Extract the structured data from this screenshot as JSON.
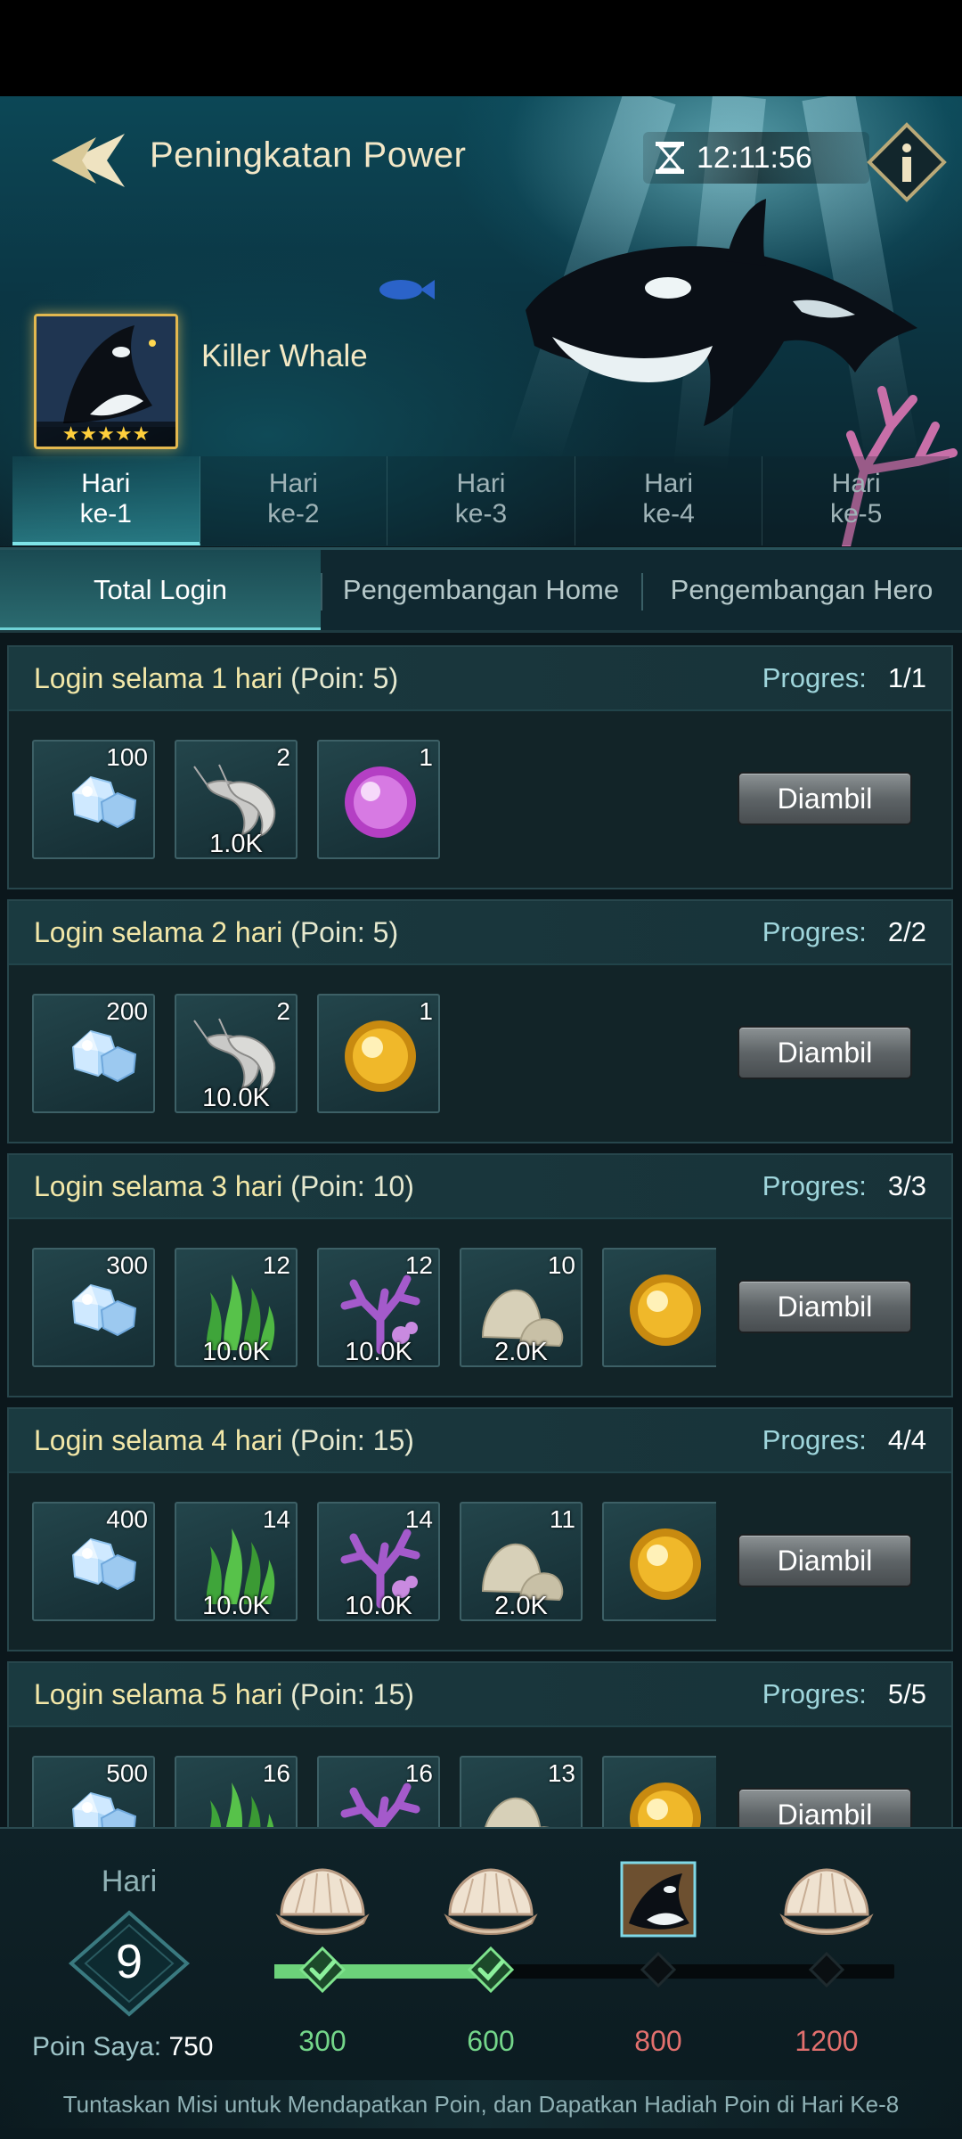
{
  "header": {
    "title": "Peningkatan Power",
    "timer": "12:11:56"
  },
  "hero": {
    "name": "Killer Whale",
    "stars": "★★★★★"
  },
  "day_tabs": [
    {
      "line1": "Hari",
      "line2": "ke-1"
    },
    {
      "line1": "Hari",
      "line2": "ke-2"
    },
    {
      "line1": "Hari",
      "line2": "ke-3"
    },
    {
      "line1": "Hari",
      "line2": "ke-4"
    },
    {
      "line1": "Hari",
      "line2": "ke-5"
    }
  ],
  "tabs": [
    "Total Login",
    "Pengembangan Home",
    "Pengembangan Hero"
  ],
  "progress_label": "Progres:",
  "claim_label": "Diambil",
  "missions": [
    {
      "title": "Login selama 1 hari",
      "points": "(Poin: 5)",
      "progress": "1/1",
      "rewards": [
        {
          "icon": "diamond-icon",
          "qty": "100",
          "amt": ""
        },
        {
          "icon": "shrimp-icon",
          "qty": "2",
          "amt": "1.0K"
        },
        {
          "icon": "purple-orb-icon",
          "qty": "1",
          "amt": ""
        }
      ]
    },
    {
      "title": "Login selama 2 hari",
      "points": "(Poin: 5)",
      "progress": "2/2",
      "rewards": [
        {
          "icon": "diamond-icon",
          "qty": "200",
          "amt": ""
        },
        {
          "icon": "shrimp-icon",
          "qty": "2",
          "amt": "10.0K"
        },
        {
          "icon": "gold-orb-icon",
          "qty": "1",
          "amt": ""
        }
      ]
    },
    {
      "title": "Login selama 3 hari",
      "points": "(Poin: 10)",
      "progress": "3/3",
      "rewards": [
        {
          "icon": "diamond-icon",
          "qty": "300",
          "amt": ""
        },
        {
          "icon": "seaweed-icon",
          "qty": "12",
          "amt": "10.0K"
        },
        {
          "icon": "coral-icon",
          "qty": "12",
          "amt": "10.0K"
        },
        {
          "icon": "stone-icon",
          "qty": "10",
          "amt": "2.0K"
        },
        {
          "icon": "gold-orb-icon",
          "qty": "",
          "amt": ""
        }
      ]
    },
    {
      "title": "Login selama 4 hari",
      "points": "(Poin: 15)",
      "progress": "4/4",
      "rewards": [
        {
          "icon": "diamond-icon",
          "qty": "400",
          "amt": ""
        },
        {
          "icon": "seaweed-icon",
          "qty": "14",
          "amt": "10.0K"
        },
        {
          "icon": "coral-icon",
          "qty": "14",
          "amt": "10.0K"
        },
        {
          "icon": "stone-icon",
          "qty": "11",
          "amt": "2.0K"
        },
        {
          "icon": "gold-orb-icon",
          "qty": "",
          "amt": ""
        }
      ]
    },
    {
      "title": "Login selama 5 hari",
      "points": "(Poin: 15)",
      "progress": "5/5",
      "rewards": [
        {
          "icon": "diamond-icon",
          "qty": "500",
          "amt": ""
        },
        {
          "icon": "seaweed-icon",
          "qty": "16",
          "amt": ""
        },
        {
          "icon": "coral-icon",
          "qty": "16",
          "amt": ""
        },
        {
          "icon": "stone-icon",
          "qty": "13",
          "amt": ""
        },
        {
          "icon": "gold-orb-icon",
          "qty": "",
          "amt": ""
        }
      ]
    }
  ],
  "footer": {
    "day_label": "Hari",
    "day_number": "9",
    "my_points_label": "Poin Saya:",
    "my_points_value": "750",
    "points_progress_fraction": 0.37,
    "milestones": [
      {
        "points": "300",
        "reached": true,
        "reward_icon": "shell-chest-icon",
        "color": "#74d68a"
      },
      {
        "points": "600",
        "reached": true,
        "reward_icon": "shell-chest-icon",
        "color": "#74d68a"
      },
      {
        "points": "800",
        "reached": false,
        "reward_icon": "orca-hero-icon",
        "color": "#e2706e"
      },
      {
        "points": "1200",
        "reached": false,
        "reward_icon": "shell-chest-icon",
        "color": "#e2706e"
      }
    ],
    "hint": "Tuntaskan Misi untuk Mendapatkan Poin, dan Dapatkan Hadiah Poin di Hari Ke-8"
  }
}
